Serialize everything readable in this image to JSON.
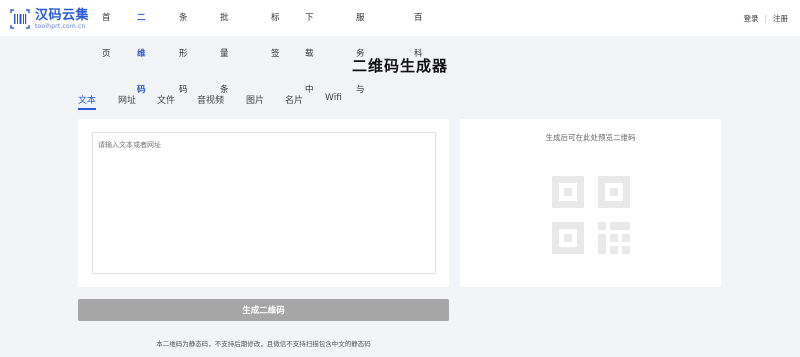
{
  "brand": {
    "title": "汉码云集",
    "subtitle": "toolhprt.com.cn",
    "accent": "#2a5bd7"
  },
  "nav": {
    "items": [
      {
        "label": "首页",
        "active": false
      },
      {
        "label": "二维码",
        "active": true
      },
      {
        "label": "条形码",
        "active": false
      },
      {
        "label": "批量条码",
        "active": false
      },
      {
        "label": "标签",
        "active": false
      },
      {
        "label": "下载中心",
        "active": false
      },
      {
        "label": "服务与支持",
        "active": false
      },
      {
        "label": "百科",
        "active": false
      }
    ]
  },
  "auth": {
    "login": "登录",
    "separator": "|",
    "register": "注册"
  },
  "page": {
    "title": "二维码生成器"
  },
  "tabs": [
    {
      "label": "文本",
      "active": true
    },
    {
      "label": "网址",
      "active": false
    },
    {
      "label": "文件",
      "active": false
    },
    {
      "label": "音视频",
      "active": false
    },
    {
      "label": "图片",
      "active": false
    },
    {
      "label": "名片",
      "active": false
    },
    {
      "label": "Wifi",
      "active": false
    }
  ],
  "input": {
    "placeholder": "请输入文本或者网址",
    "value": ""
  },
  "preview": {
    "hint": "生成后可在此处预览二维码",
    "icon": "qr-code-placeholder-icon"
  },
  "actions": {
    "generate_label": "生成二维码",
    "generate_color": "#a6a6a6"
  },
  "footnote": "本二维码为静态码，不支持后期修改，且微信不支持扫描包含中文的静态码"
}
